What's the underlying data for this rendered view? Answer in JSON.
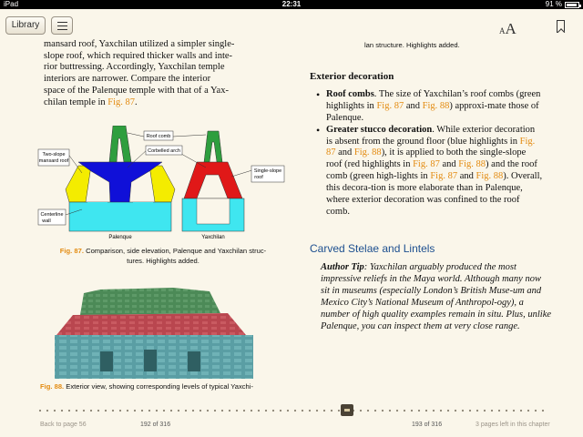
{
  "status_bar": {
    "device": "iPad",
    "time": "22:31",
    "battery": "91 %",
    "battery_level": 0.91
  },
  "toolbar": {
    "library_label": "Library",
    "font_small": "A",
    "font_large": "A"
  },
  "left_page": {
    "body_lines": [
      "mansard roof, Yaxchilan utilized a simpler single-",
      "slope roof, which required thicker walls and inte-",
      "rior buttressing. Accordingly, Yaxchilan temple",
      "interiors are narrower. Compare the interior",
      "space of the Palenque temple with that of a Yax-"
    ],
    "last_line_text": "chilan temple in ",
    "last_line_link": "Fig. 87",
    "last_line_end": ".",
    "figure87": {
      "labels": {
        "roof_comb": "Roof comb",
        "corbelled_arch": "Corbelled arch",
        "two_slope": "Two-slope",
        "mansard_roof": "mansard roof",
        "single_slope": "Single-slope",
        "roof": "roof",
        "centerline": "Centerline",
        "wall": "wall",
        "palenque": "Palenque",
        "yaxchilan": "Yaxchilan"
      },
      "caption_num": "Fig. 87.",
      "caption_line1": " Comparison, side elevation, Palenque and Yaxchilan struc-",
      "caption_line2": "tures. Highlights added."
    },
    "figure88": {
      "caption_num": "Fig. 88.",
      "caption_text": " Exterior view, showing corresponding levels of typical Yaxchi-"
    }
  },
  "right_page": {
    "carryover": "lan structure. Highlights added.",
    "exterior_heading": "Exterior decoration",
    "bullet1": {
      "term": "Roof combs",
      "t1": ". The size of Yaxchilan’s roof combs (green highlights in ",
      "link1": "Fig. 87",
      "t2": " and ",
      "link2": "Fig. 88",
      "t3": ") approxi-mate those of Palenque."
    },
    "bullet2": {
      "term": "Greater stucco decoration",
      "t1": ". While exterior decoration is absent from the ground floor (blue highlights in ",
      "link1": "Fig. 87",
      "t2": " and ",
      "link2": "Fig. 88",
      "t3": "), it is applied to both the single-slope roof (red highlights in ",
      "link3": "Fig. 87",
      "t4": " and ",
      "link4": "Fig. 88",
      "t5": ") and the roof comb (green high-lights in ",
      "link5": "Fig. 87",
      "t6": " and ",
      "link6": "Fig. 88",
      "t7": "). Overall, this decora-tion is more elaborate than in Palenque, where exterior decoration was confined to the roof comb."
    },
    "section_title": "Carved Stelae and Lintels",
    "author_tip_label": "Author Tip",
    "author_tip_text": ": Yaxchilan arguably produced the most impressive reliefs in the Maya world. Although many now sit in museums (especially London’s British Muse-um and Mexico City’s National Museum of Anthropol-ogy), a number of high quality examples remain in situ. Plus, unlike Palenque, you can inspect them at very close range."
  },
  "footer": {
    "back_link": "Back to page 56",
    "left_page_num": "192 of 316",
    "right_page_num": "193 of 316",
    "pages_left": "3 pages left in this chapter"
  },
  "colors": {
    "link": "#e38b11",
    "section_title": "#1d4f8f",
    "green": "#2e9e3e",
    "red": "#e01818",
    "blue": "#1010d8",
    "yellow": "#f4ec00",
    "cyan": "#3fe6f0",
    "page_bg": "#faf6ea"
  },
  "icons": {
    "toc": "list-icon",
    "font": "font-size-icon",
    "bookmark": "bookmark-icon"
  }
}
